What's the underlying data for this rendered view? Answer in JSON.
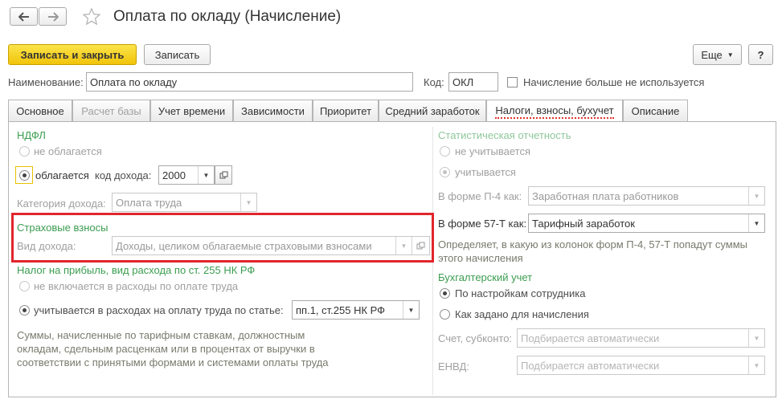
{
  "window": {
    "title": "Оплата по окладу (Начисление)",
    "back_icon": "arrow-left-icon",
    "forward_icon": "arrow-right-icon",
    "star_icon": "star-icon"
  },
  "toolbar": {
    "save_close_label": "Записать и закрыть",
    "save_label": "Записать",
    "more_label": "Еще",
    "help_label": "?"
  },
  "header": {
    "name_label": "Наименование:",
    "name_value": "Оплата по окладу",
    "code_label": "Код:",
    "code_value": "ОКЛ",
    "unused_label": "Начисление больше не используется",
    "unused_checked": false
  },
  "tabs": [
    {
      "label": "Основное",
      "state": "normal"
    },
    {
      "label": "Расчет базы",
      "state": "disabled"
    },
    {
      "label": "Учет времени",
      "state": "normal"
    },
    {
      "label": "Зависимости",
      "state": "normal"
    },
    {
      "label": "Приоритет",
      "state": "normal"
    },
    {
      "label": "Средний заработок",
      "state": "normal"
    },
    {
      "label": "Налоги, взносы, бухучет",
      "state": "active"
    },
    {
      "label": "Описание",
      "state": "normal"
    }
  ],
  "ndfl": {
    "header": "НДФЛ",
    "not_taxed_label": "не облагается",
    "taxed_label": "облагается",
    "income_code_label": "код дохода:",
    "income_code_value": "2000",
    "income_category_label": "Категория дохода:",
    "income_category_value": "Оплата труда"
  },
  "insurance": {
    "header": "Страховые взносы",
    "income_type_label": "Вид дохода:",
    "income_type_value": "Доходы, целиком облагаемые страховыми взносами",
    "highlight_color": "#e0262c"
  },
  "profit_tax": {
    "header": "Налог на прибыль, вид расхода по ст. 255 НК РФ",
    "not_included_label": "не включается в расходы по оплате труда",
    "included_label": "учитывается в расходах на оплату труда по статье:",
    "article_value": "пп.1, ст.255 НК РФ",
    "note_lines": [
      "Суммы, начисленные по тарифным ставкам, должностным",
      "окладам, сдельным расценкам или в процентах от выручки в",
      "соответствии с принятыми формами и системами оплаты труда"
    ]
  },
  "stats": {
    "header": "Статистическая отчетность",
    "not_counted_label": "не учитывается",
    "counted_label": "учитывается",
    "p4_label": "В форме П-4 как:",
    "p4_value": "Заработная плата работников",
    "f57_label": "В форме 57-Т как:",
    "f57_value": "Тарифный заработок",
    "note_lines": [
      "Определяет, в какую из колонок форм П-4, 57-Т попадут суммы",
      "этого начисления"
    ]
  },
  "accounting": {
    "header": "Бухгалтерский учет",
    "by_employee_label": "По настройкам сотрудника",
    "as_set_label": "Как задано для начисления",
    "account_label": "Счет, субконто:",
    "account_placeholder": "Подбирается автоматически",
    "envd_label": "ЕНВД:",
    "envd_placeholder": "Подбирается автоматически"
  },
  "colors": {
    "accent_yellow": "#f6d21e",
    "header_green": "#3b9d50",
    "active_tab_underline": "#e0342c"
  }
}
